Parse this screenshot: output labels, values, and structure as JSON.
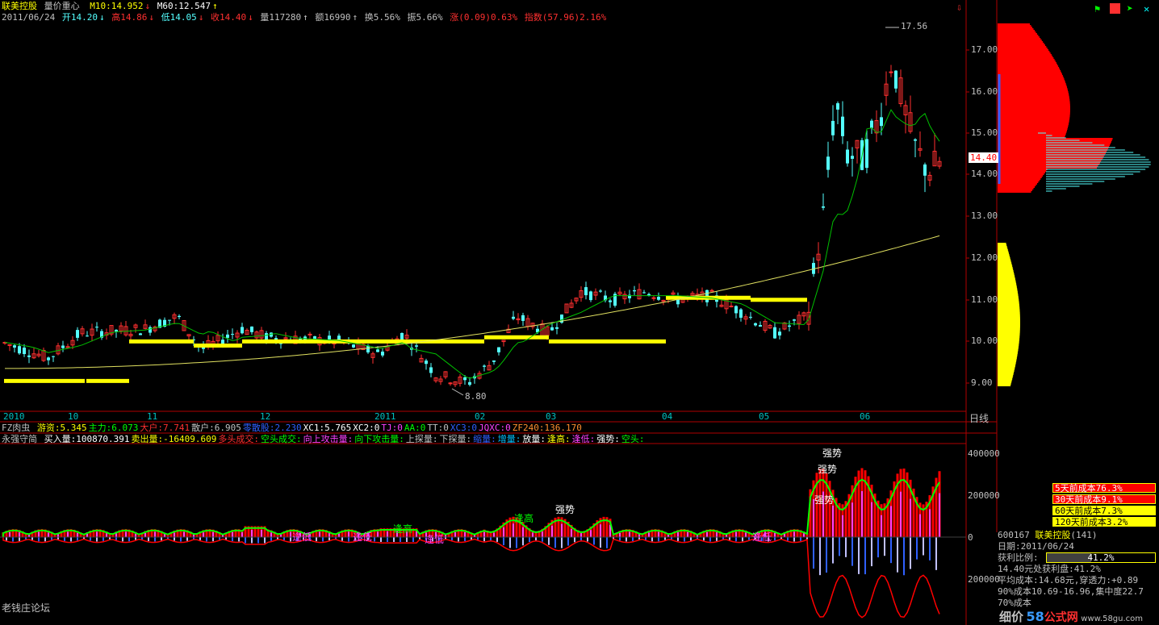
{
  "window": {
    "stock_title": "联美控股",
    "view_name": "量价重心",
    "ma10_label": "M10:14.952",
    "ma60_label": "M60:12.547"
  },
  "quote_bar": {
    "date": "2011/06/24",
    "open": "开14.20",
    "high": "高14.86",
    "low": "低14.05",
    "close": "收14.40",
    "volume": "量117280",
    "amount": "额16990",
    "turnover": "换5.56%",
    "amplitude": "振5.66%",
    "strength": "涨(0.09)0.63%",
    "index": "指数(57.96)2.16%"
  },
  "price_axis": {
    "labels": [
      "17.00",
      "16.00",
      "15.00",
      "14.00",
      "13.00",
      "12.00",
      "11.00",
      "10.00",
      "9.00"
    ],
    "current_price": "14.40",
    "high_marker": "17.56",
    "low_marker": "8.80"
  },
  "time_axis": {
    "labels": [
      "2010",
      "10",
      "11",
      "12",
      "2011",
      "02",
      "03",
      "04",
      "05",
      "06"
    ],
    "period": "日线"
  },
  "indicator1": {
    "name": "FZ肉虫",
    "items": [
      {
        "text": "游资:5.345",
        "color": "#ffff00"
      },
      {
        "text": "主力:6.073",
        "color": "#00ff00"
      },
      {
        "text": "大户:7.741",
        "color": "#ff3030"
      },
      {
        "text": "散户:6.905",
        "color": "#c0c0c0"
      },
      {
        "text": "零散股:2.230",
        "color": "#3060ff"
      },
      {
        "text": "XC1:5.765",
        "color": "#ffffff"
      },
      {
        "text": "XC2:0",
        "color": "#ffffff"
      },
      {
        "text": "TJ:0",
        "color": "#ff40ff"
      },
      {
        "text": "AA:0",
        "color": "#00ff00"
      },
      {
        "text": "TT:0",
        "color": "#c0c0c0"
      },
      {
        "text": "XC3:0",
        "color": "#3060ff"
      },
      {
        "text": "JQXC:0",
        "color": "#ff40ff"
      },
      {
        "text": "ZF240:136.170",
        "color": "#ff9030"
      }
    ]
  },
  "indicator2": {
    "name": "永强守简",
    "items": [
      {
        "text": "买入量:100870.391",
        "color": "#ffffff"
      },
      {
        "text": "卖出量:-16409.609",
        "color": "#ffff00"
      },
      {
        "text": "多头成交:",
        "color": "#ff3030"
      },
      {
        "text": "空头成交:",
        "color": "#00ff00"
      },
      {
        "text": "向上攻击量:",
        "color": "#ff40ff"
      },
      {
        "text": "向下攻击量:",
        "color": "#00ff00"
      },
      {
        "text": "上探量:",
        "color": "#c0c0c0"
      },
      {
        "text": "下探量:",
        "color": "#c0c0c0"
      },
      {
        "text": "缩量:",
        "color": "#3060ff"
      },
      {
        "text": "增量:",
        "color": "#00c0ff"
      },
      {
        "text": "放量:",
        "color": "#ffffff"
      },
      {
        "text": "逢高:",
        "color": "#ffff00"
      },
      {
        "text": "逢低:",
        "color": "#ff40ff"
      },
      {
        "text": "强势:",
        "color": "#ffffff"
      },
      {
        "text": "空头:",
        "color": "#00ff00"
      }
    ],
    "axis_labels": [
      "400000",
      "200000",
      "0",
      "200000"
    ],
    "signals": {
      "strong": "强势",
      "sell_high": "逢高",
      "buy_low": "逢低"
    }
  },
  "chip_panel": {
    "costs": [
      {
        "text": "5天前成本76.3%",
        "bg": "#ff0000",
        "fg": "#ffffff"
      },
      {
        "text": "30天前成本9.1%",
        "bg": "#ff0000",
        "fg": "#ffffff"
      },
      {
        "text": "60天前成本7.3%",
        "bg": "#ffff00",
        "fg": "#000000"
      },
      {
        "text": "120天前成本3.2%",
        "bg": "#ffff00",
        "fg": "#000000"
      }
    ],
    "code_line": "600167",
    "name_line": "联美控股",
    "name_suffix": "(141)",
    "date_line": "日期:2011/06/24",
    "profit_label": "获利比例:",
    "profit_value": "41.2%",
    "profit_fraction": 0.412,
    "profit_line": "14.40元处获利盘:41.2%",
    "avg_line": "平均成本:14.68元,穿透力:+0.89",
    "cost90_line": "90%成本10.69-16.96,集中度22.7",
    "cost70_line": "70%成本"
  },
  "footer": {
    "forum": "老钱庄论坛",
    "watermark_a": "细价",
    "watermark_b": "58",
    "watermark_c": "公式网",
    "watermark_url": "www.58gu.com"
  },
  "colors": {
    "up": "#ff3030",
    "down": "#54ffff",
    "yellow_line": "#ffff00",
    "ma_green": "#00c000",
    "ma_yellow": "#e0e060",
    "grid_red": "#b00000"
  }
}
